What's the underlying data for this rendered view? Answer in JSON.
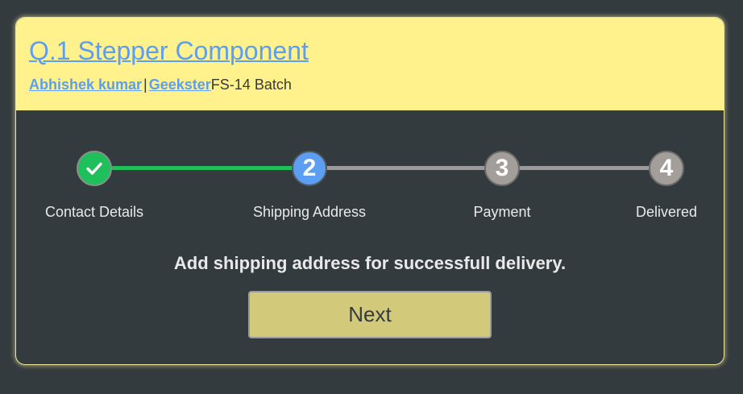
{
  "header": {
    "title": "Q.1 Stepper Component",
    "author": "Abhishek kumar",
    "separator": "|",
    "org": "Geekster",
    "batch": "FS-14 Batch"
  },
  "stepper": {
    "current_step": 2,
    "steps": [
      {
        "number": "1",
        "label": "Contact Details",
        "state": "done",
        "icon": "check-icon"
      },
      {
        "number": "2",
        "label": "Shipping Address",
        "state": "active"
      },
      {
        "number": "3",
        "label": "Payment",
        "state": "pending"
      },
      {
        "number": "4",
        "label": "Delivered",
        "state": "pending"
      }
    ]
  },
  "message": "Add shipping address for successfull delivery.",
  "next_button": "Next",
  "colors": {
    "header_bg": "#fff18c",
    "body_bg": "#343b3f",
    "link": "#5b9ef2",
    "done": "#1fbf5c",
    "active": "#5b9ef2",
    "pending": "#a39e9a",
    "button": "#d2c97a"
  }
}
